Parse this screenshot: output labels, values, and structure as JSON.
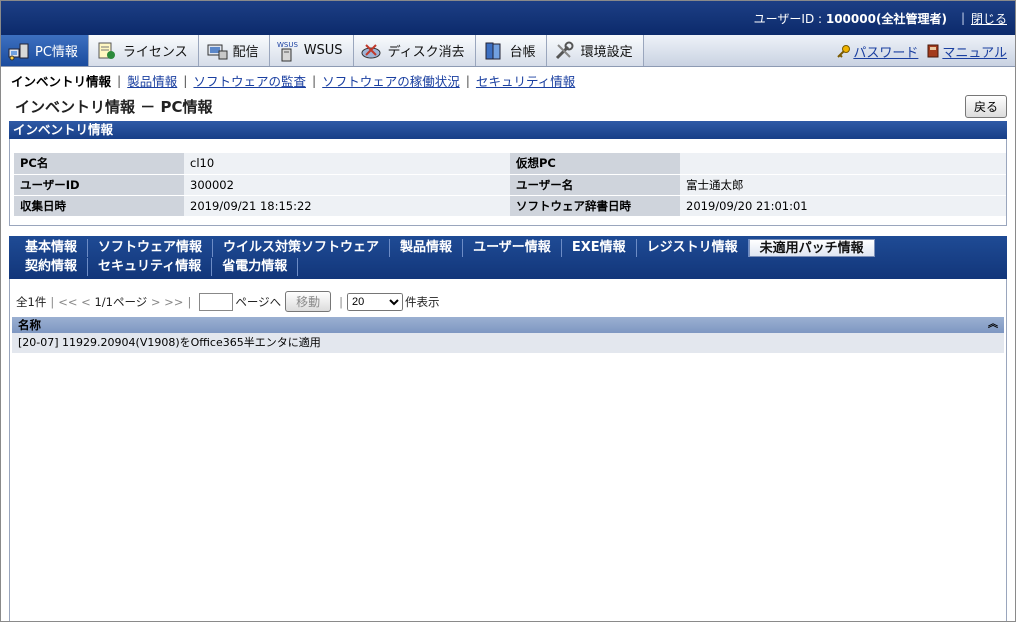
{
  "topbar": {
    "user_label": "ユーザーID : ",
    "user_id": "100000(全社管理者)",
    "close_label": "閉じる"
  },
  "mainnav": {
    "tabs": [
      {
        "label": "PC情報",
        "icon": "pc-icon",
        "active": true
      },
      {
        "label": "ライセンス",
        "icon": "license-icon"
      },
      {
        "label": "配信",
        "icon": "delivery-icon"
      },
      {
        "label": "WSUS",
        "icon": "wsus-icon"
      },
      {
        "label": "ディスク消去",
        "icon": "disk-erase-icon"
      },
      {
        "label": "台帳",
        "icon": "ledger-icon"
      },
      {
        "label": "環境設定",
        "icon": "settings-icon"
      }
    ],
    "password_label": "パスワード",
    "manual_label": "マニュアル"
  },
  "subnav": {
    "items": [
      "インベントリ情報",
      "製品情報",
      "ソフトウェアの監査",
      "ソフトウェアの稼働状況",
      "セキュリティ情報"
    ]
  },
  "page": {
    "title": "インベントリ情報 － PC情報",
    "back_label": "戻る"
  },
  "inventory": {
    "section_title": "インベントリ情報",
    "rows": [
      {
        "l1": "PC名",
        "v1": "cl10",
        "l2": "仮想PC",
        "v2": ""
      },
      {
        "l1": "ユーザーID",
        "v1": "300002",
        "l2": "ユーザー名",
        "v2": "富士通太郎"
      },
      {
        "l1": "収集日時",
        "v1": "2019/09/21 18:15:22",
        "l2": "ソフトウェア辞書日時",
        "v2": "2019/09/20 21:01:01"
      }
    ]
  },
  "tabs": {
    "row1": [
      "基本情報",
      "ソフトウェア情報",
      "ウイルス対策ソフトウェア",
      "製品情報",
      "ユーザー情報",
      "EXE情報",
      "レジストリ情報",
      "未適用パッチ情報"
    ],
    "row2": [
      "契約情報",
      "セキュリティ情報",
      "省電力情報"
    ],
    "active": "未適用パッチ情報"
  },
  "pager": {
    "total": "全1件",
    "first": "<<",
    "prev": "<",
    "page_info": "1/1ページ",
    "next": ">",
    "last": ">>",
    "goto_suffix": "ページへ",
    "move_label": "移動",
    "per_page_value": "20",
    "per_page_suffix": "件表示"
  },
  "list": {
    "column_header": "名称",
    "rows": [
      "[20-07] 11929.20904(V1908)をOffice365半エンタに適用"
    ]
  },
  "colors": {
    "topbar_bg": "#0c2a6b",
    "active_tab_bg": "#1b4c9e",
    "link": "#1a3fa0",
    "label_bg": "#cfd4dc"
  }
}
